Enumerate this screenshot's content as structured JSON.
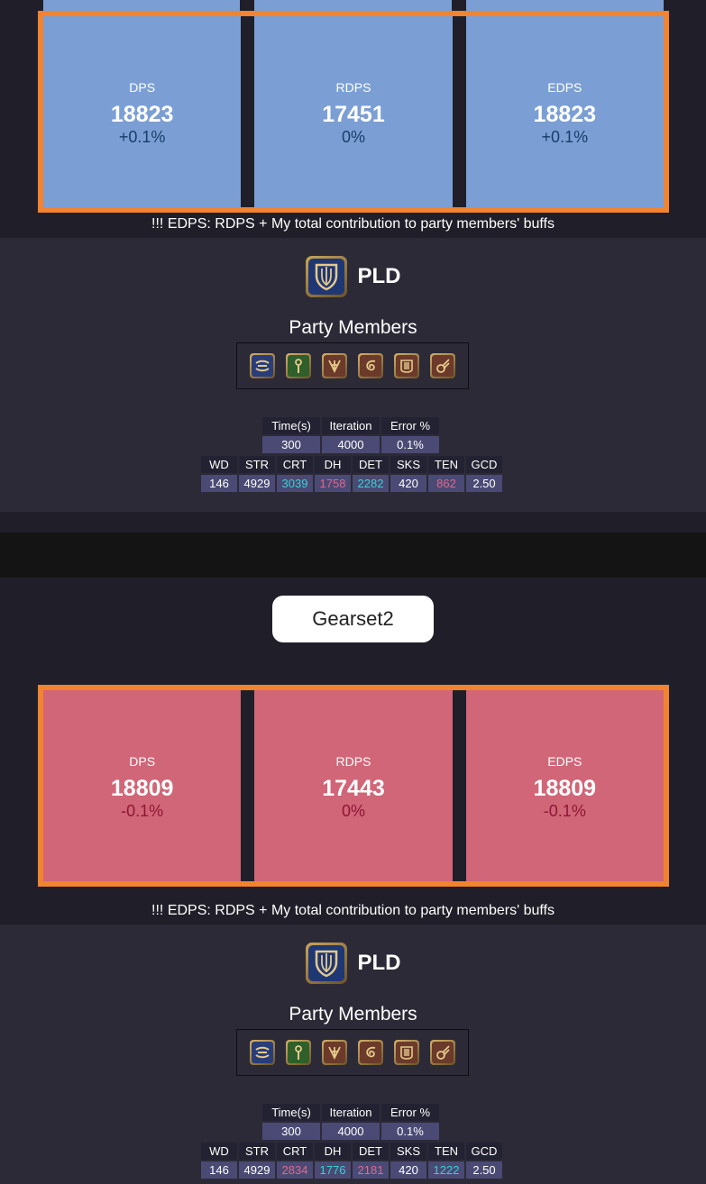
{
  "note_text": "!!! EDPS: RDPS + My total contribution to party members' buffs",
  "gearset1": {
    "stats": [
      {
        "label": "DPS",
        "value": "18823",
        "delta": "+0.1%"
      },
      {
        "label": "RDPS",
        "value": "17451",
        "delta": "0%"
      },
      {
        "label": "EDPS",
        "value": "18823",
        "delta": "+0.1%"
      }
    ],
    "job": "PLD",
    "party_title": "Party Members",
    "sim_headers": [
      "Time(s)",
      "Iteration",
      "Error %"
    ],
    "sim_values": [
      "300",
      "4000",
      "0.1%"
    ],
    "stat_headers": [
      "WD",
      "STR",
      "CRT",
      "DH",
      "DET",
      "SKS",
      "TEN",
      "GCD"
    ],
    "stat_values": [
      "146",
      "4929",
      "3039",
      "1758",
      "2282",
      "420",
      "862",
      "2.50"
    ]
  },
  "gearset2": {
    "name": "Gearset2",
    "stats": [
      {
        "label": "DPS",
        "value": "18809",
        "delta": "-0.1%"
      },
      {
        "label": "RDPS",
        "value": "17443",
        "delta": "0%"
      },
      {
        "label": "EDPS",
        "value": "18809",
        "delta": "-0.1%"
      }
    ],
    "job": "PLD",
    "party_title": "Party Members",
    "sim_headers": [
      "Time(s)",
      "Iteration",
      "Error %"
    ],
    "sim_values": [
      "300",
      "4000",
      "0.1%"
    ],
    "stat_headers": [
      "WD",
      "STR",
      "CRT",
      "DH",
      "DET",
      "SKS",
      "TEN",
      "GCD"
    ],
    "stat_values": [
      "146",
      "4929",
      "2834",
      "1776",
      "2181",
      "420",
      "1222",
      "2.50"
    ]
  },
  "party_icons": [
    "warrior-icon",
    "white-mage-icon",
    "samurai-icon",
    "bard-icon",
    "summoner-icon",
    "black-mage-icon"
  ],
  "colors": {
    "accent_border": "#f2832f",
    "increase_bg": "#7b9fd4",
    "decrease_bg": "#d06677",
    "stat_up": "#3ad0d6",
    "stat_down": "#de6a8e"
  }
}
